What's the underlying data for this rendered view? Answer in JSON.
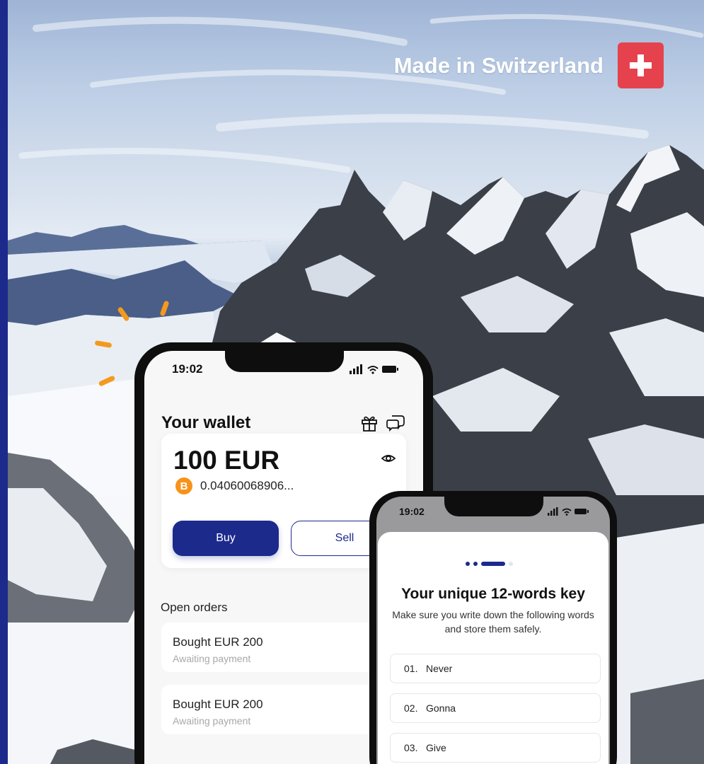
{
  "badge": {
    "text": "Made in Switzerland",
    "flag_icon": "swiss-flag-icon",
    "flag_color": "#e5424d"
  },
  "colors": {
    "brand": "#1c2a8c",
    "bitcoin": "#f7931a",
    "sparkle": "#f39a1e"
  },
  "wallet_phone": {
    "time": "19:02",
    "title": "Your wallet",
    "balance": "100 EUR",
    "btc_symbol": "B",
    "btc_amount": "0.04060068906...",
    "buy_label": "Buy",
    "sell_label": "Sell",
    "open_orders_label": "Open orders",
    "orders": [
      {
        "title": "Bought EUR 200",
        "status": "Awaiting payment"
      },
      {
        "title": "Bought EUR 200",
        "status": "Awaiting payment"
      }
    ]
  },
  "key_phone": {
    "time": "19:02",
    "title": "Your unique 12-words key",
    "description": "Make sure you write down the following words and store them safely.",
    "words": [
      {
        "num": "01.",
        "word": "Never"
      },
      {
        "num": "02.",
        "word": "Gonna"
      },
      {
        "num": "03.",
        "word": "Give"
      }
    ]
  }
}
